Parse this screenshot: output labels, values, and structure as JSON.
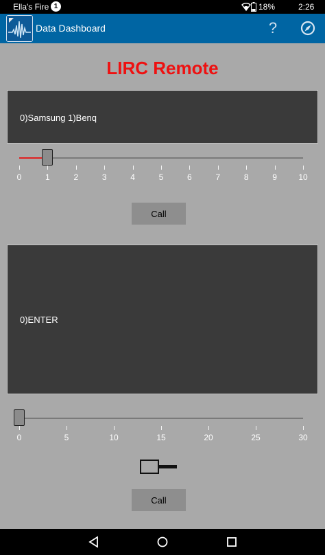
{
  "status_bar": {
    "device_name": "Ella's Fire",
    "notification_count": "1",
    "battery": "18%",
    "time": "2:26",
    "icons": [
      "wifi-icon",
      "battery-icon"
    ]
  },
  "app_bar": {
    "title": "Data Dashboard",
    "help_label": "?",
    "icons": [
      "app-logo-icon",
      "help-icon",
      "compass-icon"
    ]
  },
  "page": {
    "title": "LIRC Remote"
  },
  "device_panel": {
    "text": "0)Samsung   1)Benq"
  },
  "device_slider": {
    "min": 0,
    "max": 10,
    "value": 1,
    "tick_labels": [
      "0",
      "1",
      "2",
      "3",
      "4",
      "5",
      "6",
      "7",
      "8",
      "9",
      "10"
    ]
  },
  "call_button_1": {
    "label": "Call"
  },
  "command_panel": {
    "text": "0)ENTER"
  },
  "command_slider": {
    "min": 0,
    "max": 30,
    "value": 0,
    "tick_labels": [
      "0",
      "5",
      "10",
      "15",
      "20",
      "25",
      "30"
    ]
  },
  "call_button_2": {
    "label": "Call"
  },
  "nav_bar": {
    "icons": [
      "back-icon",
      "home-icon",
      "recents-icon"
    ]
  },
  "colors": {
    "app_bar": "#0065a3",
    "title_red": "#ee1111",
    "background": "#a9a9a9",
    "panel": "#3a3a3a"
  }
}
